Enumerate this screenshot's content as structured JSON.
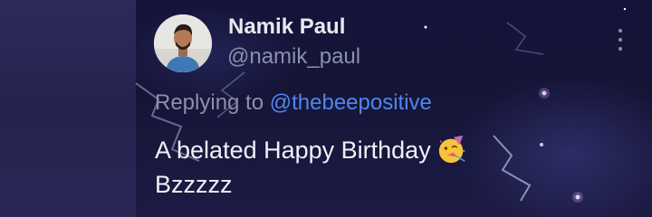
{
  "tweet": {
    "author_name": "Namik Paul",
    "author_handle": "@namik_paul",
    "replying_prefix": "Replying to",
    "replying_handle": "@thebeepositive",
    "text_line1": "A belated Happy Birthday",
    "text_line2": "Bzzzzz",
    "emoji": "partying-face-emoji"
  },
  "colors": {
    "name": "#e9e9ef",
    "secondary": "#8c8fab",
    "mention": "#4f86ee",
    "body_text": "#f1f1f5",
    "background": "#161538"
  },
  "icons": {
    "menu": "more-vertical-icon"
  }
}
